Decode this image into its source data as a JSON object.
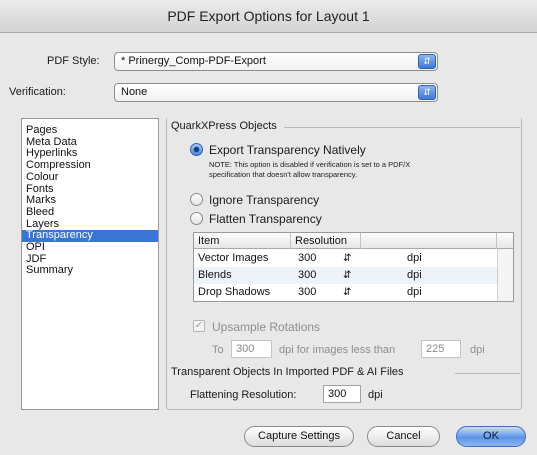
{
  "window": {
    "title": "PDF Export Options for Layout 1"
  },
  "pdf_style": {
    "label": "PDF Style:",
    "value": "* Prinergy_Comp-PDF-Export"
  },
  "verification": {
    "label": "Verification:",
    "value": "None"
  },
  "sidebar": {
    "items": [
      {
        "label": "Pages",
        "selected": false
      },
      {
        "label": "Meta Data",
        "selected": false
      },
      {
        "label": "Hyperlinks",
        "selected": false
      },
      {
        "label": "Compression",
        "selected": false
      },
      {
        "label": "Colour",
        "selected": false
      },
      {
        "label": "Fonts",
        "selected": false
      },
      {
        "label": "Marks",
        "selected": false
      },
      {
        "label": "Bleed",
        "selected": false
      },
      {
        "label": "Layers",
        "selected": false
      },
      {
        "label": "Transparency",
        "selected": true
      },
      {
        "label": "OPI",
        "selected": false
      },
      {
        "label": "JDF",
        "selected": false
      },
      {
        "label": "Summary",
        "selected": false
      }
    ]
  },
  "quark_objects": {
    "title": "QuarkXPress Objects",
    "export_native": {
      "label": "Export Transparency Natively",
      "checked": true
    },
    "note_line1": "NOTE: This option is disabled if verification is set to a PDF/X",
    "note_line2": "specification that doesn't allow transparency.",
    "ignore": {
      "label": "Ignore Transparency",
      "checked": false
    },
    "flatten": {
      "label": "Flatten Transparency",
      "checked": false
    }
  },
  "table": {
    "headers": {
      "item": "Item",
      "resolution": "Resolution"
    },
    "rows": [
      {
        "item": "Vector Images",
        "value": "300",
        "unit": "dpi"
      },
      {
        "item": "Blends",
        "value": "300",
        "unit": "dpi"
      },
      {
        "item": "Drop Shadows",
        "value": "300",
        "unit": "dpi"
      }
    ]
  },
  "upsample": {
    "label": "Upsample Rotations",
    "checked": true,
    "to_label": "To",
    "to_value": "300",
    "mid_label": "dpi for images less than",
    "threshold_value": "225",
    "unit": "dpi"
  },
  "imported": {
    "title": "Transparent Objects In Imported PDF & AI Files",
    "flatten_label": "Flattening Resolution:",
    "flatten_value": "300",
    "unit": "dpi"
  },
  "buttons": {
    "capture": "Capture Settings",
    "cancel": "Cancel",
    "ok": "OK"
  },
  "colors": {
    "accent": "#3875d7",
    "selection": "#3875d7"
  }
}
